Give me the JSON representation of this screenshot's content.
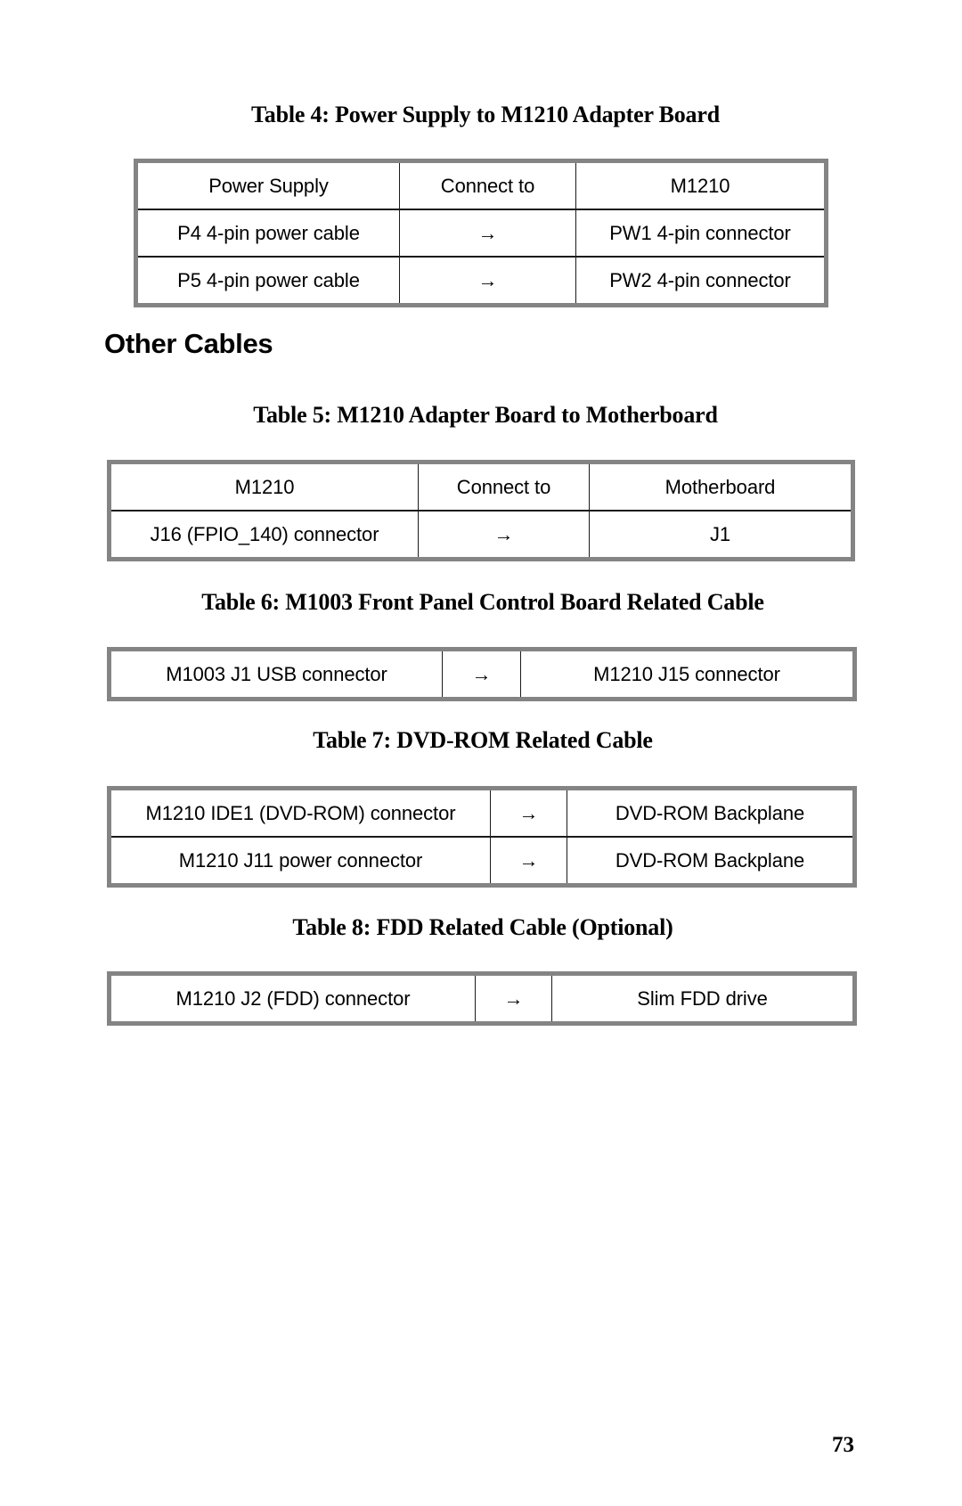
{
  "page_number": "73",
  "section_heading": "Other Cables",
  "tables": [
    {
      "caption": "Table 4: Power Supply to M1210 Adapter Board",
      "rows": [
        [
          "Power Supply",
          "Connect to",
          "M1210"
        ],
        [
          "P4 4-pin power cable",
          "→",
          "PW1 4-pin connector"
        ],
        [
          "P5 4-pin power cable",
          "→",
          "PW2 4-pin connector"
        ]
      ]
    },
    {
      "caption": "Table 5: M1210 Adapter Board to Motherboard",
      "rows": [
        [
          "M1210",
          "Connect to",
          "Motherboard"
        ],
        [
          "J16 (FPIO_140) connector",
          "→",
          "J1"
        ]
      ]
    },
    {
      "caption": "Table 6: M1003 Front Panel Control Board Related Cable",
      "rows": [
        [
          "M1003 J1 USB connector",
          "→",
          "M1210 J15 connector"
        ]
      ]
    },
    {
      "caption": "Table 7: DVD-ROM Related Cable",
      "rows": [
        [
          "M1210 IDE1 (DVD-ROM) connector",
          "→",
          "DVD-ROM Backplane"
        ],
        [
          "M1210 J11 power connector",
          "→",
          "DVD-ROM Backplane"
        ]
      ]
    },
    {
      "caption": "Table 8: FDD Related Cable (Optional)",
      "rows": [
        [
          "M1210 J2 (FDD) connector",
          "→",
          "Slim FDD drive"
        ]
      ]
    }
  ]
}
